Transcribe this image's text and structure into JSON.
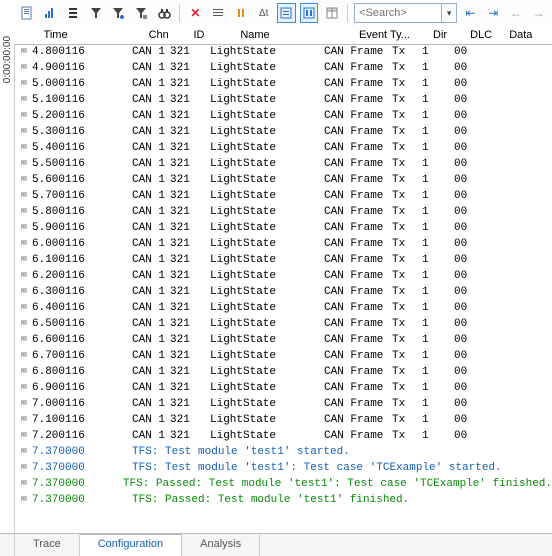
{
  "sidebar_text": "0:00:00:00",
  "search_placeholder": "<Search>",
  "headers": {
    "time": "Time",
    "chn": "Chn",
    "id": "ID",
    "name": "Name",
    "evt": "Event Ty...",
    "dir": "Dir",
    "dlc": "DLC",
    "data": "Data"
  },
  "rows": [
    {
      "time": "4.800116",
      "chn": "CAN 1",
      "id": "321",
      "name": "LightState",
      "evt": "CAN Frame",
      "dir": "Tx",
      "dlc": "1",
      "data": "00"
    },
    {
      "time": "4.900116",
      "chn": "CAN 1",
      "id": "321",
      "name": "LightState",
      "evt": "CAN Frame",
      "dir": "Tx",
      "dlc": "1",
      "data": "00"
    },
    {
      "time": "5.000116",
      "chn": "CAN 1",
      "id": "321",
      "name": "LightState",
      "evt": "CAN Frame",
      "dir": "Tx",
      "dlc": "1",
      "data": "00"
    },
    {
      "time": "5.100116",
      "chn": "CAN 1",
      "id": "321",
      "name": "LightState",
      "evt": "CAN Frame",
      "dir": "Tx",
      "dlc": "1",
      "data": "00"
    },
    {
      "time": "5.200116",
      "chn": "CAN 1",
      "id": "321",
      "name": "LightState",
      "evt": "CAN Frame",
      "dir": "Tx",
      "dlc": "1",
      "data": "00"
    },
    {
      "time": "5.300116",
      "chn": "CAN 1",
      "id": "321",
      "name": "LightState",
      "evt": "CAN Frame",
      "dir": "Tx",
      "dlc": "1",
      "data": "00"
    },
    {
      "time": "5.400116",
      "chn": "CAN 1",
      "id": "321",
      "name": "LightState",
      "evt": "CAN Frame",
      "dir": "Tx",
      "dlc": "1",
      "data": "00"
    },
    {
      "time": "5.500116",
      "chn": "CAN 1",
      "id": "321",
      "name": "LightState",
      "evt": "CAN Frame",
      "dir": "Tx",
      "dlc": "1",
      "data": "00"
    },
    {
      "time": "5.600116",
      "chn": "CAN 1",
      "id": "321",
      "name": "LightState",
      "evt": "CAN Frame",
      "dir": "Tx",
      "dlc": "1",
      "data": "00"
    },
    {
      "time": "5.700116",
      "chn": "CAN 1",
      "id": "321",
      "name": "LightState",
      "evt": "CAN Frame",
      "dir": "Tx",
      "dlc": "1",
      "data": "00"
    },
    {
      "time": "5.800116",
      "chn": "CAN 1",
      "id": "321",
      "name": "LightState",
      "evt": "CAN Frame",
      "dir": "Tx",
      "dlc": "1",
      "data": "00"
    },
    {
      "time": "5.900116",
      "chn": "CAN 1",
      "id": "321",
      "name": "LightState",
      "evt": "CAN Frame",
      "dir": "Tx",
      "dlc": "1",
      "data": "00"
    },
    {
      "time": "6.000116",
      "chn": "CAN 1",
      "id": "321",
      "name": "LightState",
      "evt": "CAN Frame",
      "dir": "Tx",
      "dlc": "1",
      "data": "00"
    },
    {
      "time": "6.100116",
      "chn": "CAN 1",
      "id": "321",
      "name": "LightState",
      "evt": "CAN Frame",
      "dir": "Tx",
      "dlc": "1",
      "data": "00"
    },
    {
      "time": "6.200116",
      "chn": "CAN 1",
      "id": "321",
      "name": "LightState",
      "evt": "CAN Frame",
      "dir": "Tx",
      "dlc": "1",
      "data": "00"
    },
    {
      "time": "6.300116",
      "chn": "CAN 1",
      "id": "321",
      "name": "LightState",
      "evt": "CAN Frame",
      "dir": "Tx",
      "dlc": "1",
      "data": "00"
    },
    {
      "time": "6.400116",
      "chn": "CAN 1",
      "id": "321",
      "name": "LightState",
      "evt": "CAN Frame",
      "dir": "Tx",
      "dlc": "1",
      "data": "00"
    },
    {
      "time": "6.500116",
      "chn": "CAN 1",
      "id": "321",
      "name": "LightState",
      "evt": "CAN Frame",
      "dir": "Tx",
      "dlc": "1",
      "data": "00"
    },
    {
      "time": "6.600116",
      "chn": "CAN 1",
      "id": "321",
      "name": "LightState",
      "evt": "CAN Frame",
      "dir": "Tx",
      "dlc": "1",
      "data": "00"
    },
    {
      "time": "6.700116",
      "chn": "CAN 1",
      "id": "321",
      "name": "LightState",
      "evt": "CAN Frame",
      "dir": "Tx",
      "dlc": "1",
      "data": "00"
    },
    {
      "time": "6.800116",
      "chn": "CAN 1",
      "id": "321",
      "name": "LightState",
      "evt": "CAN Frame",
      "dir": "Tx",
      "dlc": "1",
      "data": "00"
    },
    {
      "time": "6.900116",
      "chn": "CAN 1",
      "id": "321",
      "name": "LightState",
      "evt": "CAN Frame",
      "dir": "Tx",
      "dlc": "1",
      "data": "00"
    },
    {
      "time": "7.000116",
      "chn": "CAN 1",
      "id": "321",
      "name": "LightState",
      "evt": "CAN Frame",
      "dir": "Tx",
      "dlc": "1",
      "data": "00"
    },
    {
      "time": "7.100116",
      "chn": "CAN 1",
      "id": "321",
      "name": "LightState",
      "evt": "CAN Frame",
      "dir": "Tx",
      "dlc": "1",
      "data": "00"
    },
    {
      "time": "7.200116",
      "chn": "CAN 1",
      "id": "321",
      "name": "LightState",
      "evt": "CAN Frame",
      "dir": "Tx",
      "dlc": "1",
      "data": "00"
    }
  ],
  "log_rows": [
    {
      "time": "7.370000",
      "msg": "TFS: Test module 'test1' started.",
      "cls": "log1"
    },
    {
      "time": "7.370000",
      "msg": "TFS: Test module 'test1': Test case 'TCExample' started.",
      "cls": "log1"
    },
    {
      "time": "7.370000",
      "msg": "TFS: Passed: Test module 'test1': Test case 'TCExample' finished.",
      "cls": "log2"
    },
    {
      "time": "7.370000",
      "msg": "TFS: Passed: Test module 'test1' finished.",
      "cls": "log2"
    }
  ],
  "tabs": {
    "trace": "Trace",
    "config": "Configuration",
    "analysis": "Analysis"
  }
}
